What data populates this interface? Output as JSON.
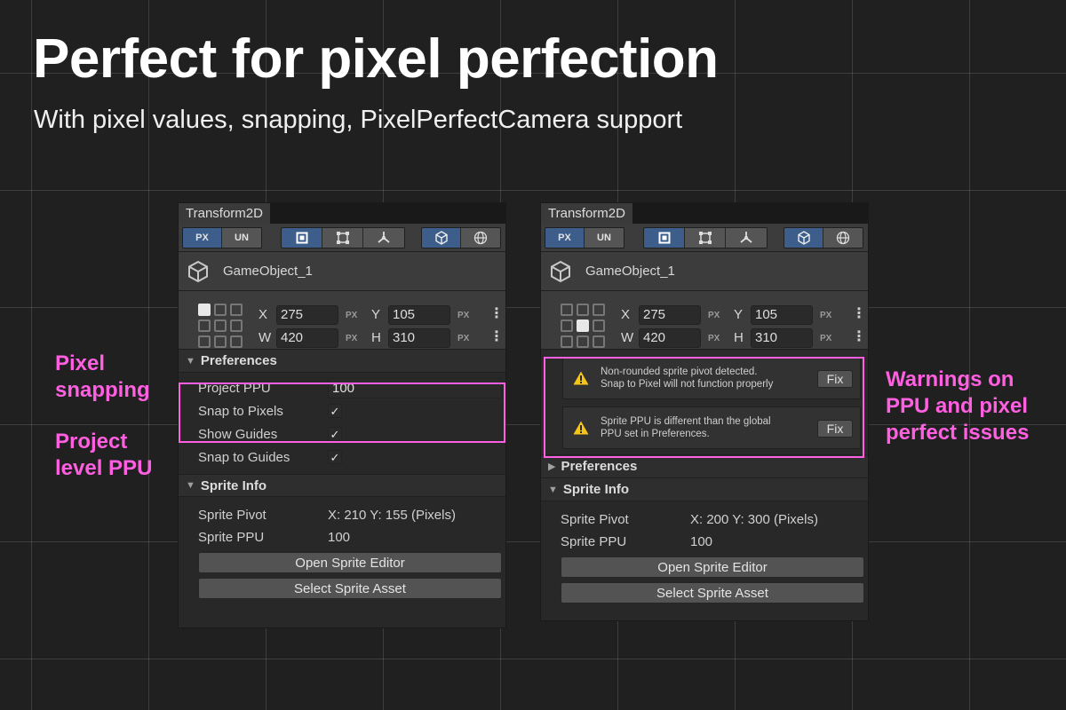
{
  "hero": {
    "title": "Perfect for pixel perfection",
    "subtitle": "With pixel values, snapping, PixelPerfectCamera support"
  },
  "callouts": {
    "pixel_snapping": [
      "Pixel",
      "snapping"
    ],
    "project_ppu": [
      "Project",
      "level PPU"
    ],
    "warnings": [
      "Warnings on",
      "PPU and pixel",
      "perfect issues"
    ]
  },
  "colors": {
    "accent_pink": "#ff5fe0",
    "active_button": "#3d5d8a",
    "warning": "#f5c518"
  },
  "panel_left": {
    "tab": "Transform2D",
    "toolbar": {
      "px": "PX",
      "un": "UN"
    },
    "object_name": "GameObject_1",
    "coords": {
      "x_label": "X",
      "x": "275",
      "y_label": "Y",
      "y": "105",
      "w_label": "W",
      "w": "420",
      "h_label": "H",
      "h": "310",
      "unit": "PX"
    },
    "preferences": {
      "title": "Preferences",
      "project_ppu_label": "Project PPU",
      "project_ppu_value": "100",
      "snap_to_pixels": "Snap to Pixels",
      "show_guides": "Show Guides",
      "snap_to_guides": "Snap to Guides",
      "check": "✓"
    },
    "sprite_info": {
      "title": "Sprite Info",
      "pivot_label": "Sprite Pivot",
      "pivot_value": "X: 210  Y: 155 (Pixels)",
      "ppu_label": "Sprite PPU",
      "ppu_value": "100",
      "open_editor": "Open Sprite Editor",
      "select_asset": "Select Sprite Asset"
    }
  },
  "panel_right": {
    "tab": "Transform2D",
    "toolbar": {
      "px": "PX",
      "un": "UN"
    },
    "object_name": "GameObject_1",
    "coords": {
      "x_label": "X",
      "x": "275",
      "y_label": "Y",
      "y": "105",
      "w_label": "W",
      "w": "420",
      "h_label": "H",
      "h": "310",
      "unit": "PX"
    },
    "warnings": [
      {
        "line1": "Non-rounded sprite pivot detected.",
        "line2": "Snap to Pixel will not function properly",
        "fix": "Fix"
      },
      {
        "line1": "Sprite PPU is different than the global",
        "line2": "PPU set in Preferences.",
        "fix": "Fix"
      }
    ],
    "preferences_title": "Preferences",
    "sprite_info": {
      "title": "Sprite Info",
      "pivot_label": "Sprite Pivot",
      "pivot_value": "X: 200  Y: 300 (Pixels)",
      "ppu_label": "Sprite PPU",
      "ppu_value": "100",
      "open_editor": "Open Sprite Editor",
      "select_asset": "Select Sprite Asset"
    }
  }
}
